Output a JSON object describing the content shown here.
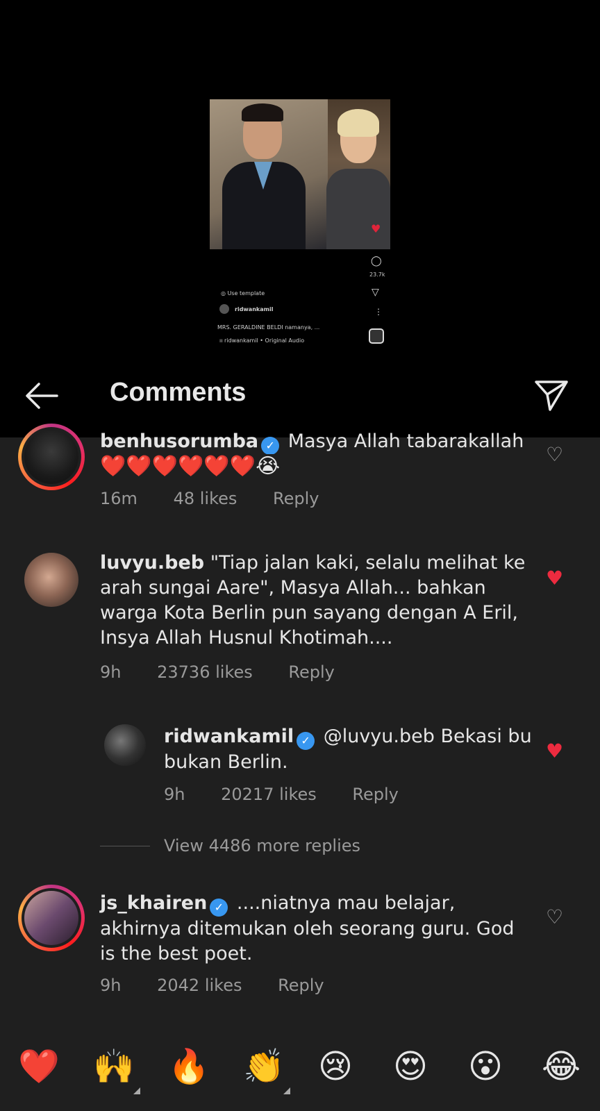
{
  "preview": {
    "comment_count": "23.7k",
    "use_template": "Use template",
    "username": "ridwankamil",
    "caption": "MRS. GERALDINE BELDI namanya, ...",
    "audio": "ridwankamil • Original Audio"
  },
  "header": {
    "title": "Comments"
  },
  "comments": [
    {
      "username": "benhusorumba",
      "verified": true,
      "text": "Masya Allah tabarakallah",
      "emojis": "❤️❤️❤️❤️❤️❤️😭",
      "time": "16m",
      "likes": "48 likes",
      "reply": "Reply",
      "liked": false
    },
    {
      "username": "luvyu.beb",
      "verified": false,
      "text": "\"Tiap jalan kaki, selalu melihat ke arah sungai Aare\", Masya Allah... bahkan warga Kota Berlin pun sayang dengan A Eril, Insya Allah Husnul Khotimah....",
      "time": "9h",
      "likes": "23736 likes",
      "reply": "Reply",
      "liked": true
    },
    {
      "username": "ridwankamil",
      "verified": true,
      "text": "@luvyu.beb Bekasi bu bukan Berlin.",
      "time": "9h",
      "likes": "20217 likes",
      "reply": "Reply",
      "liked": true
    },
    {
      "username": "js_khairen",
      "verified": true,
      "text": "....niatnya mau belajar, akhirnya ditemukan oleh seorang guru. God is the best poet.",
      "time": "9h",
      "likes": "2042 likes",
      "reply": "Reply",
      "liked": false
    }
  ],
  "view_more": "View 4486 more replies",
  "quick_emojis": [
    "❤️",
    "🙌",
    "🔥",
    "👏",
    "😢",
    "😍",
    "😮",
    "😂"
  ]
}
